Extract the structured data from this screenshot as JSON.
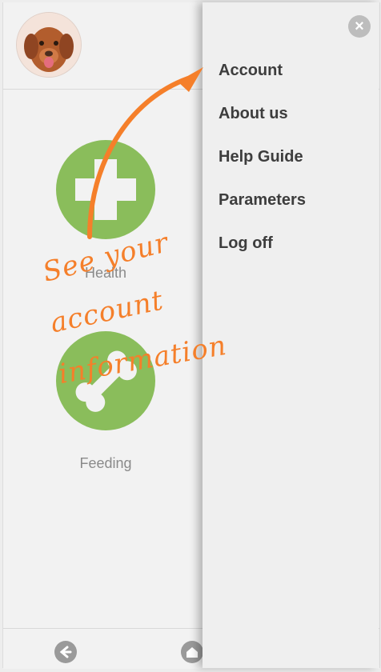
{
  "menu": {
    "items": [
      "Account",
      "About us",
      "Help Guide",
      "Parameters",
      "Log off"
    ]
  },
  "tiles": [
    {
      "label": "Health",
      "icon": "cross-icon"
    },
    {
      "label": "Feeding",
      "icon": "bone-icon"
    }
  ],
  "annotation": {
    "line1": "See your",
    "line2": "account",
    "line3": "information"
  },
  "colors": {
    "tile_green": "#8abd5b",
    "annotation_orange": "#f57f2a"
  },
  "icons": [
    "dog-avatar",
    "close-icon",
    "back-arrow-icon",
    "home-icon",
    "annotation-arrow"
  ]
}
